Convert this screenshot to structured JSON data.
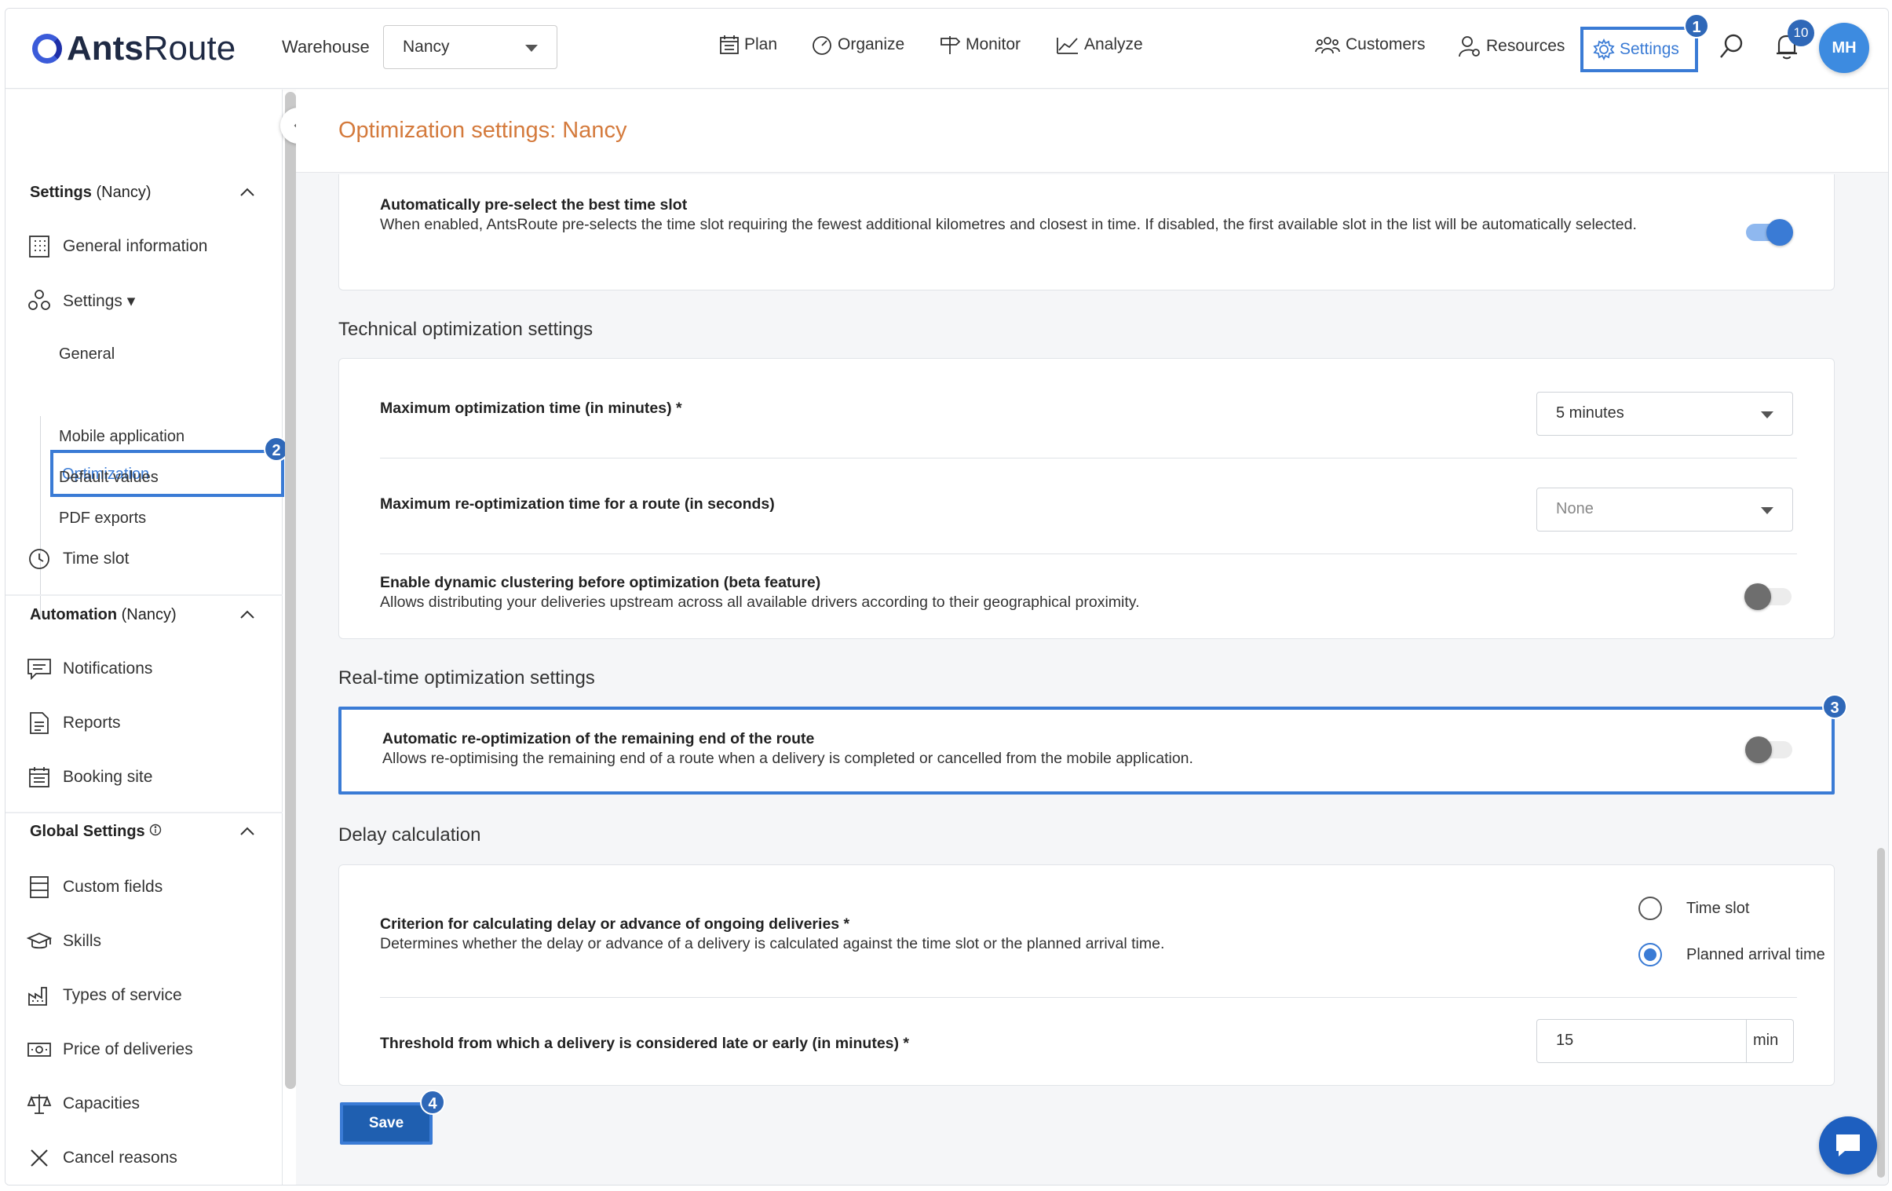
{
  "app": {
    "logo_bold": "Ants",
    "logo_light": "Route"
  },
  "header": {
    "warehouse_label": "Warehouse",
    "warehouse_value": "Nancy",
    "nav": {
      "plan": "Plan",
      "organize": "Organize",
      "monitor": "Monitor",
      "analyze": "Analyze",
      "customers": "Customers",
      "resources": "Resources",
      "settings": "Settings"
    },
    "notification_count": "10",
    "avatar_initials": "MH"
  },
  "badges": {
    "b1": "1",
    "b2": "2",
    "b3": "3",
    "b4": "4"
  },
  "sidebar": {
    "settings_head_bold": "Settings",
    "settings_head_rest": " (Nancy)",
    "general_information": "General information",
    "settings_item": "Settings ▾",
    "sub": {
      "general": "General",
      "optimization": "Optimization",
      "mobile": "Mobile application",
      "defaults": "Default values",
      "pdf": "PDF exports"
    },
    "time_slot": "Time slot",
    "automation_head_bold": "Automation",
    "automation_head_rest": " (Nancy)",
    "notifications": "Notifications",
    "reports": "Reports",
    "booking": "Booking site",
    "global_head_bold": "Global Settings",
    "custom_fields": "Custom fields",
    "skills": "Skills",
    "types_of_service": "Types of service",
    "price_of_deliveries": "Price of deliveries",
    "capacities": "Capacities",
    "cancel_reasons": "Cancel reasons"
  },
  "main": {
    "title": "Optimization settings: Nancy",
    "preselect": {
      "title": "Automatically pre-select the best time slot",
      "desc": "When enabled, AntsRoute pre-selects the time slot requiring the fewest additional kilometres and closest in time. If disabled, the first available slot in the list will be automatically selected.",
      "enabled": true
    },
    "technical": {
      "heading": "Technical optimization settings",
      "max_time_label": "Maximum optimization time (in minutes) *",
      "max_time_value": "5 minutes",
      "max_reopt_label": "Maximum re-optimization time for a route (in seconds)",
      "max_reopt_value": "None",
      "clustering_title": "Enable dynamic clustering before optimization (beta feature)",
      "clustering_desc": "Allows distributing your deliveries upstream across all available drivers according to their geographical proximity.",
      "clustering_enabled": false
    },
    "realtime": {
      "heading": "Real-time optimization settings",
      "reopt_title": "Automatic re-optimization of the remaining end of the route",
      "reopt_desc": "Allows re-optimising the remaining end of a route when a delivery is completed or cancelled from the mobile application.",
      "reopt_enabled": false
    },
    "delay": {
      "heading": "Delay calculation",
      "criterion_title": "Criterion for calculating delay or advance of ongoing deliveries *",
      "criterion_desc": "Determines whether the delay or advance of a delivery is calculated against the time slot or the planned arrival time.",
      "option_time_slot": "Time slot",
      "option_planned": "Planned arrival time",
      "selected": "Planned arrival time",
      "threshold_label": "Threshold from which a delivery is considered late or early (in minutes) *",
      "threshold_value": "15",
      "threshold_unit": "min"
    },
    "save_label": "Save"
  },
  "colors": {
    "accent": "#3a7bd5",
    "title_orange": "#d47a3c",
    "save": "#1f5fb0"
  }
}
